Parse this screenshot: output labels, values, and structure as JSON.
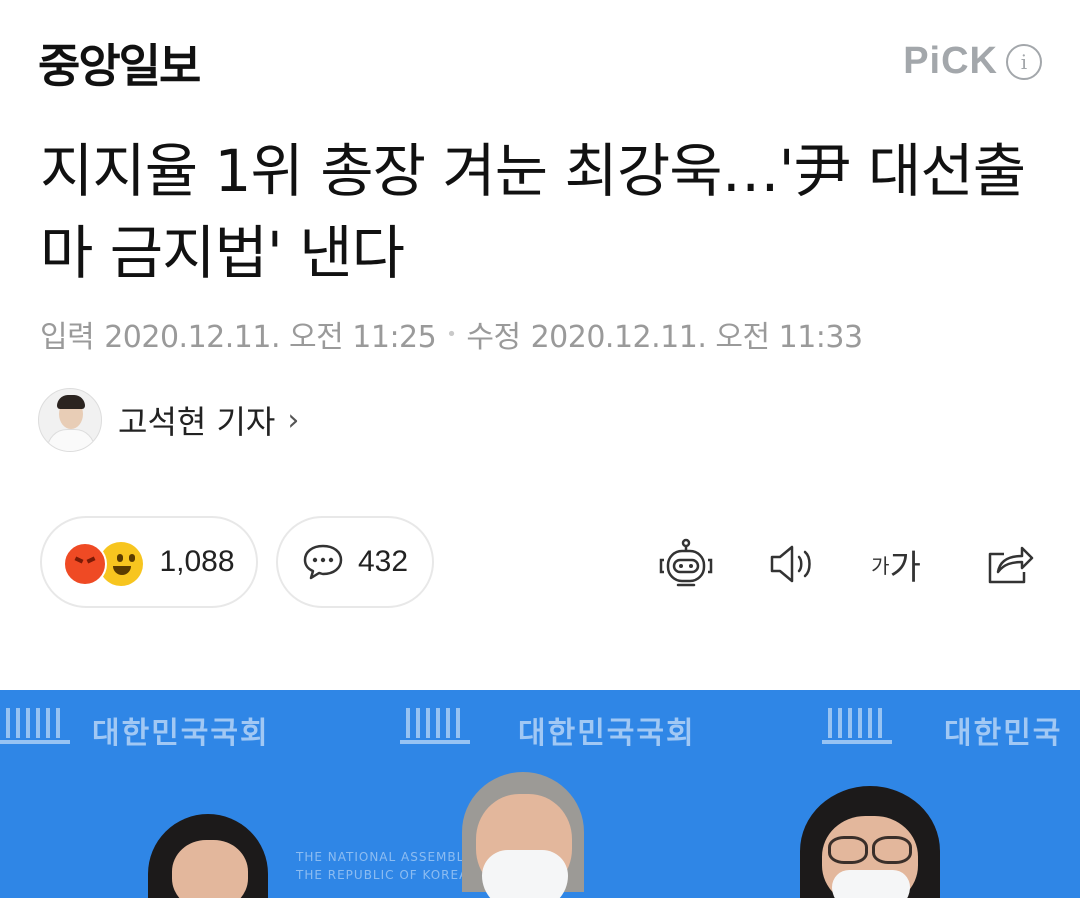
{
  "header": {
    "publisher": "중앙일보",
    "pick_label": "PiCK",
    "info_glyph": "i"
  },
  "article": {
    "title": "지지율 1위 총장 겨눈 최강욱…'尹 대선출마 금지법' 낸다",
    "input_label": "입력",
    "input_datetime": "2020.12.11. 오전 11:25",
    "separator": "•",
    "modified_label": "수정",
    "modified_datetime": "2020.12.11. 오전 11:33"
  },
  "reporter": {
    "name": "고석현 기자",
    "chevron": "›"
  },
  "actions": {
    "reaction_count": "1,088",
    "comment_count": "432",
    "font_small": "가",
    "font_big": "가"
  },
  "photo": {
    "banner_text": "대한민국국회",
    "banner_text_partial": "대한민국",
    "small_text_1": "THE NATIONAL ASSEMBLY",
    "small_text_2": "THE REPUBLIC OF KOREA"
  },
  "icons": [
    "info-icon",
    "angry-emoji-icon",
    "happy-emoji-icon",
    "comment-bubble-icon",
    "robot-icon",
    "speaker-icon",
    "font-size-icon",
    "share-icon",
    "chevron-right-icon"
  ],
  "colors": {
    "pick_gray": "#a3a7ab",
    "photo_blue": "#2f86e6",
    "angry_red": "#ef4a24",
    "happy_yellow": "#f7c51f"
  }
}
